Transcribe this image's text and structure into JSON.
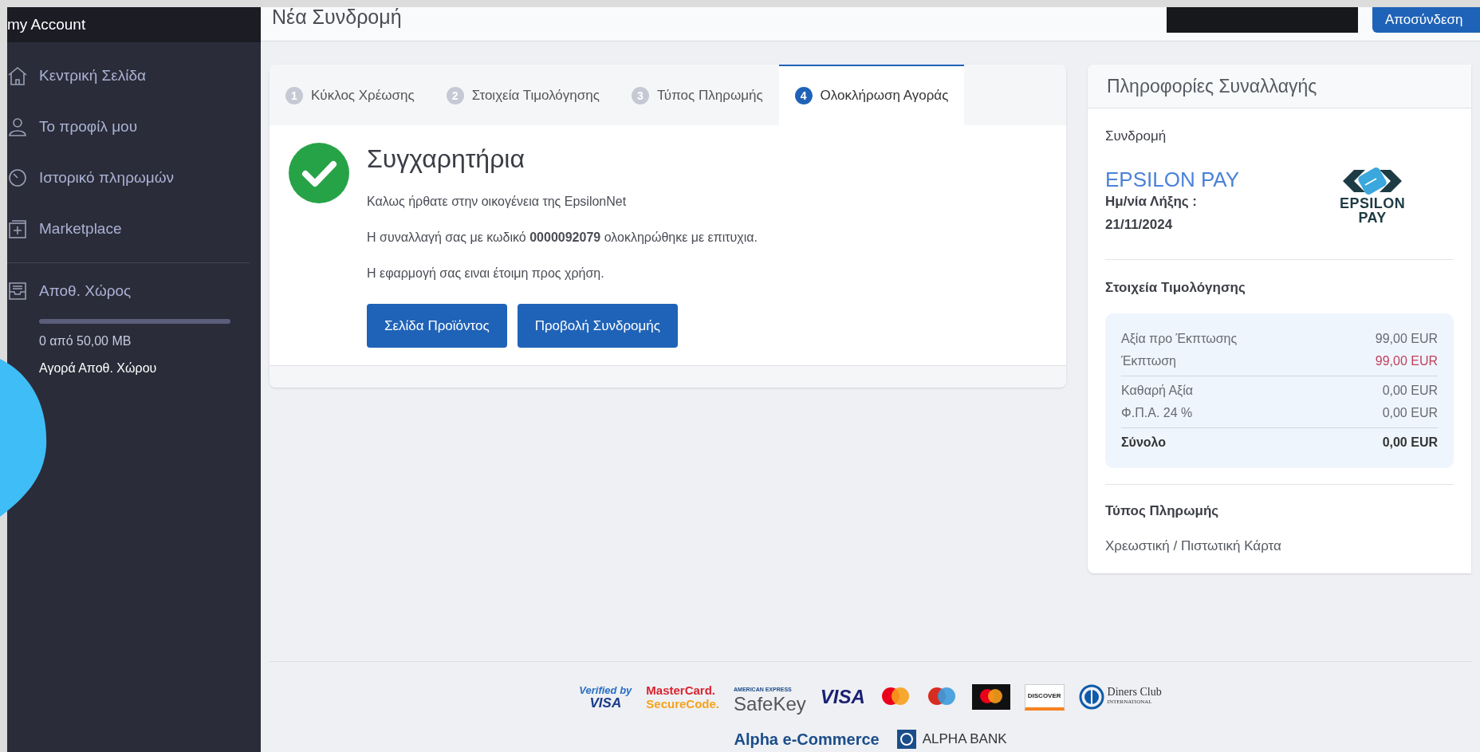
{
  "sidebar": {
    "title": "my Account",
    "items": [
      {
        "label": "Κεντρική Σελίδα"
      },
      {
        "label": "Το προφίλ μου"
      },
      {
        "label": "Ιστορικό πληρωμών"
      },
      {
        "label": "Marketplace"
      }
    ],
    "storage": {
      "label": "Αποθ. Χώρος",
      "usage": "0 από 50,00 MB",
      "link": "Αγορά Αποθ. Χώρου"
    }
  },
  "header": {
    "title": "Νέα Συνδρομή",
    "logout": "Αποσύνδεση"
  },
  "wizard": {
    "tabs": [
      {
        "number": "1",
        "label": "Κύκλος Χρέωσης",
        "selected": false
      },
      {
        "number": "2",
        "label": "Στοιχεία Τιμολόγησης",
        "selected": false
      },
      {
        "number": "3",
        "label": "Τύπος Πληρωμής",
        "selected": false
      },
      {
        "number": "4",
        "label": "Ολοκλήρωση Αγοράς",
        "selected": true
      }
    ],
    "heading": "Συγχαρητήρια",
    "lines": [
      "Καλως ήρθατε στην οικογένεια της EpsilonNet",
      "Η συναλλαγή σας με κωδικό **0000092079** ολοκληρώθηκε με επιτυχια.",
      "Η εφαρμογή σας ειναι έτοιμη προς χρήση."
    ],
    "buttons": [
      "Σελίδα Προϊόντος",
      "Προβολή Συνδρομής"
    ]
  },
  "transaction": {
    "title": "Πληροφορίες Συναλλαγής",
    "subscription": {
      "heading": "Συνδρομή",
      "product": "EPSILON PAY",
      "expiry_label": "Ημ/νία Λήξης :",
      "expiry_date": "21/11/2024",
      "logo_lines": [
        "EPSILON",
        "PAY"
      ]
    },
    "billing": {
      "heading": "Στοιχεία Τιμολόγησης",
      "groups": [
        {
          "rows": [
            {
              "label": "Αξία προ Έκπτωσης",
              "value": "99,00 EUR",
              "kind": "plain"
            },
            {
              "label": "Έκπτωση",
              "value": "99,00 EUR",
              "kind": "discount"
            }
          ]
        },
        {
          "rows": [
            {
              "label": "Καθαρή Αξία",
              "value": "0,00 EUR",
              "kind": "plain"
            },
            {
              "label": "Φ.Π.Α. 24 %",
              "value": "0,00 EUR",
              "kind": "plain"
            }
          ]
        },
        {
          "rows": [
            {
              "label": "Σύνολο",
              "value": "0,00 EUR",
              "kind": "total"
            }
          ]
        }
      ]
    },
    "payment": {
      "heading": "Τύπος Πληρωμής",
      "method": "Χρεωστική / Πιστωτική Κάρτα"
    }
  },
  "footer": {
    "card_logos": [
      {
        "kind": "verified_visa",
        "lines": [
          "Verified by",
          "VISA"
        ]
      },
      {
        "kind": "securecode",
        "lines": [
          "MasterCard.",
          "SecureCode."
        ]
      },
      {
        "kind": "safekey",
        "lines": [
          "AMERICAN EXPRESS",
          "SafeKey"
        ]
      },
      {
        "kind": "visa",
        "lines": [
          "VISA"
        ]
      },
      {
        "kind": "mastercard"
      },
      {
        "kind": "maestro"
      },
      {
        "kind": "mastercard_dark"
      },
      {
        "kind": "discover",
        "lines": [
          "DISCOVER"
        ]
      },
      {
        "kind": "diners",
        "lines": [
          "Diners Club",
          "INTERNATIONAL"
        ]
      }
    ],
    "program": "Alpha e-Commerce",
    "bank": "ALPHA BANK"
  }
}
